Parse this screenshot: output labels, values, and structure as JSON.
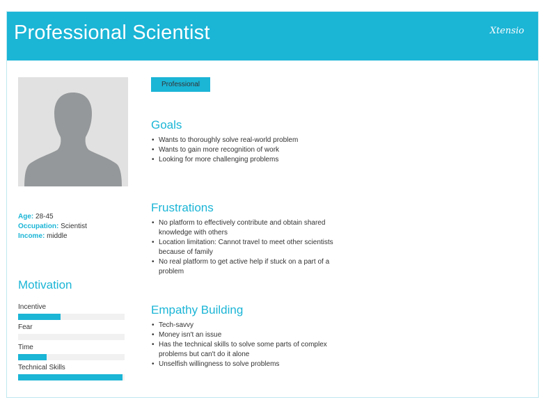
{
  "header": {
    "title": "Professional Scientist",
    "brand": "Xtensio",
    "background_color": "#1bb5d6"
  },
  "profile": {
    "photo_icon": "person-silhouette-icon",
    "tag": "Professional",
    "age_label": "Age:",
    "age": "28-45",
    "occupation_label": "Occupation:",
    "occupation": "Scientist",
    "income_label": "Income:",
    "income": "middle"
  },
  "motivation": {
    "title": "Motivation",
    "items": [
      {
        "label": "Incentive",
        "level": 0.4
      },
      {
        "label": "Fear",
        "level": 0
      },
      {
        "label": "Time",
        "level": 0.27
      },
      {
        "label": "Technical Skills",
        "level": 0.98
      }
    ]
  },
  "goals": {
    "title": "Goals",
    "items": [
      "Wants to thoroughly solve real-world problem",
      "Wants to gain more recognition of work",
      "Looking for more challenging problems"
    ]
  },
  "frustrations": {
    "title": "Frustrations",
    "items": [
      "No platform to effectively contribute and obtain shared knowledge with others",
      "Location limitation: Cannot travel to meet other scientists because of family",
      "No real platform to get active help if stuck on a part of a problem"
    ]
  },
  "empathy": {
    "title": "Empathy Building",
    "items": [
      "Tech-savvy",
      "Money isn't an issue",
      "Has the technical skills to solve some parts of complex problems but can't do it alone",
      "Unselfish willingness to solve problems"
    ]
  },
  "colors": {
    "accent": "#1bb5d6",
    "track": "#f1f1f1",
    "text": "#333333"
  }
}
